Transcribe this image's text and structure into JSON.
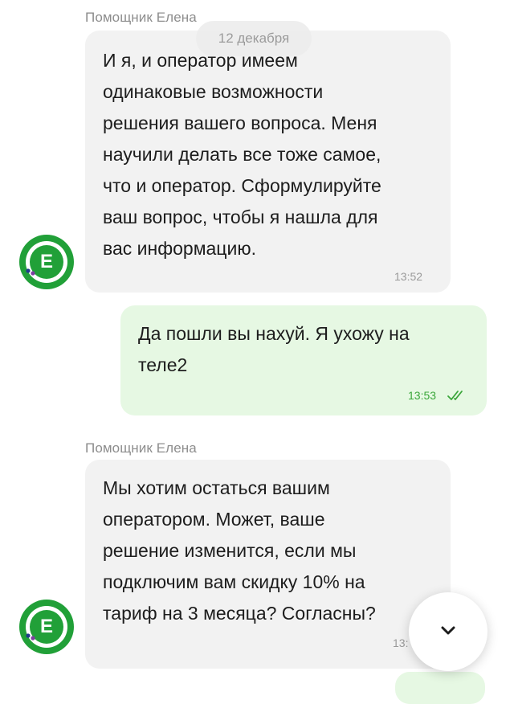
{
  "date_chip": "12 декабря",
  "messages": [
    {
      "sender": "Помощник Елена",
      "text": "И я, и оператор имеем\nодинаковые возможности\nрешения вашего вопроса. Меня\nнаучили делать все тоже самое,\nчто и оператор. Сформулируйте\nваш вопрос, чтобы я нашла для\nвас информацию.",
      "time": "13:52"
    },
    {
      "text": "Да пошли вы нахуй. Я ухожу на\nтеле2",
      "time": "13:53",
      "status": "read"
    },
    {
      "sender": "Помощник Елена",
      "text": "Мы хотим остаться вашим\nоператором. Может, ваше\nрешение изменится, если мы\nподключим вам скидку 10% на\nтариф на 3 месяца? Согласны?",
      "time": "13:"
    }
  ],
  "avatar_letter": "E",
  "icons": {
    "scroll_down": "chevron-down-icon",
    "read_status": "double-check-icon"
  },
  "colors": {
    "brand_green": "#21a038",
    "incoming_bubble": "#f2f2f2",
    "outgoing_bubble": "#e6f8e3",
    "outgoing_time": "#3aa63a"
  }
}
